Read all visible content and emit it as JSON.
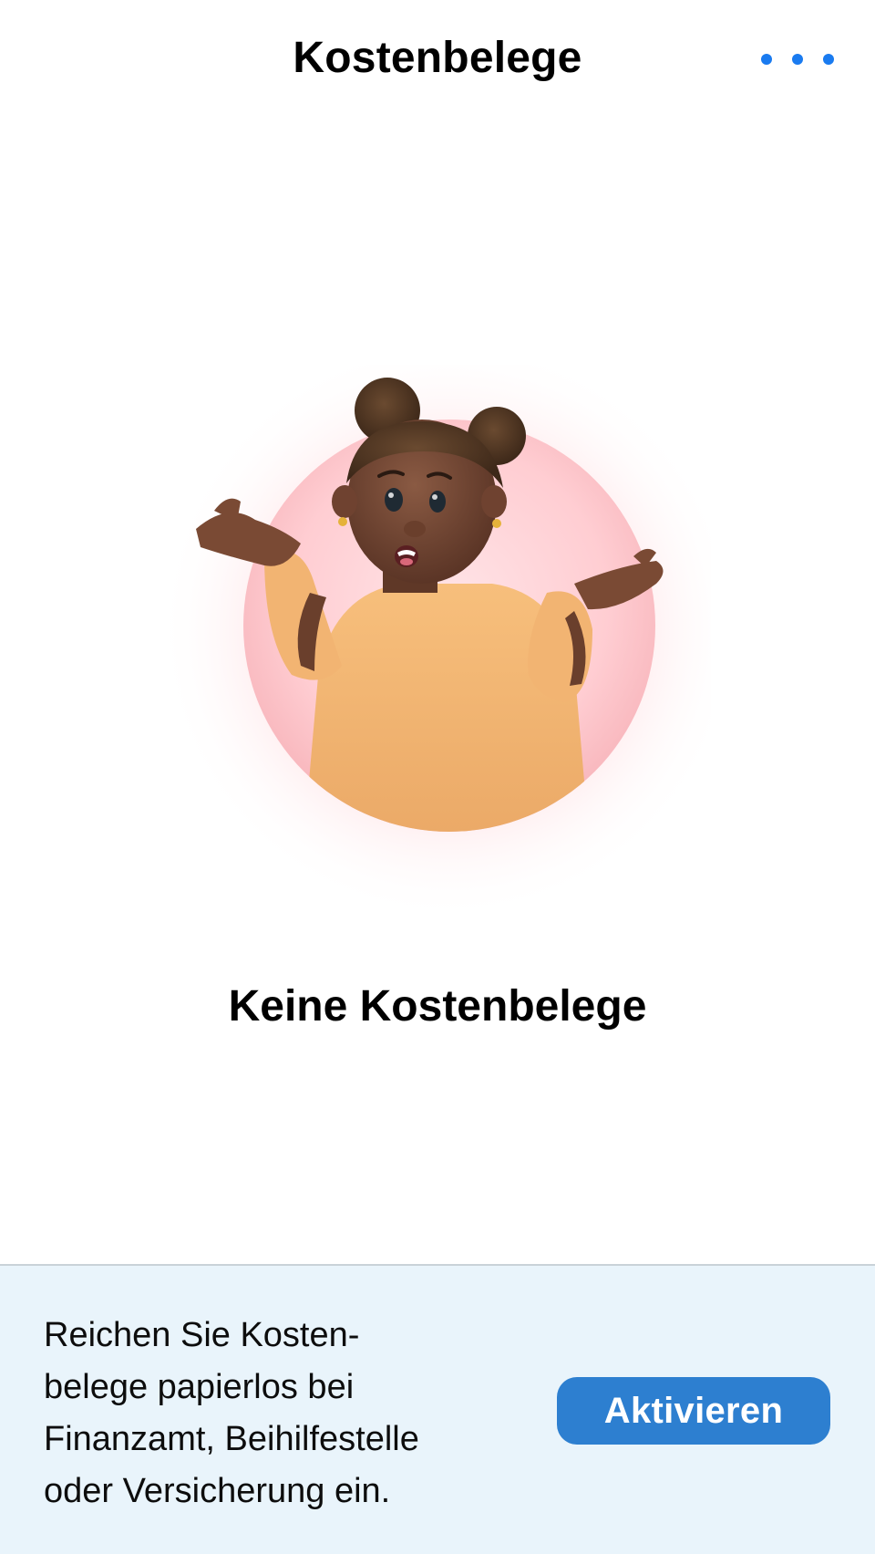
{
  "header": {
    "title": "Kostenbelege",
    "more_icon": "ellipsis-icon",
    "accent_color": "#1a7bf0"
  },
  "empty_state": {
    "illustration": "shrugging-person-illustration",
    "title": "Keine Kostenbelege"
  },
  "banner": {
    "text_lines": [
      "Reichen Sie Kosten-",
      "belege papierlos bei",
      "Finanzamt, Beihilfestelle",
      "oder Versicherung ein."
    ],
    "button_label": "Aktivieren",
    "button_color": "#2d7fd0",
    "background_color": "#e9f4fb"
  }
}
